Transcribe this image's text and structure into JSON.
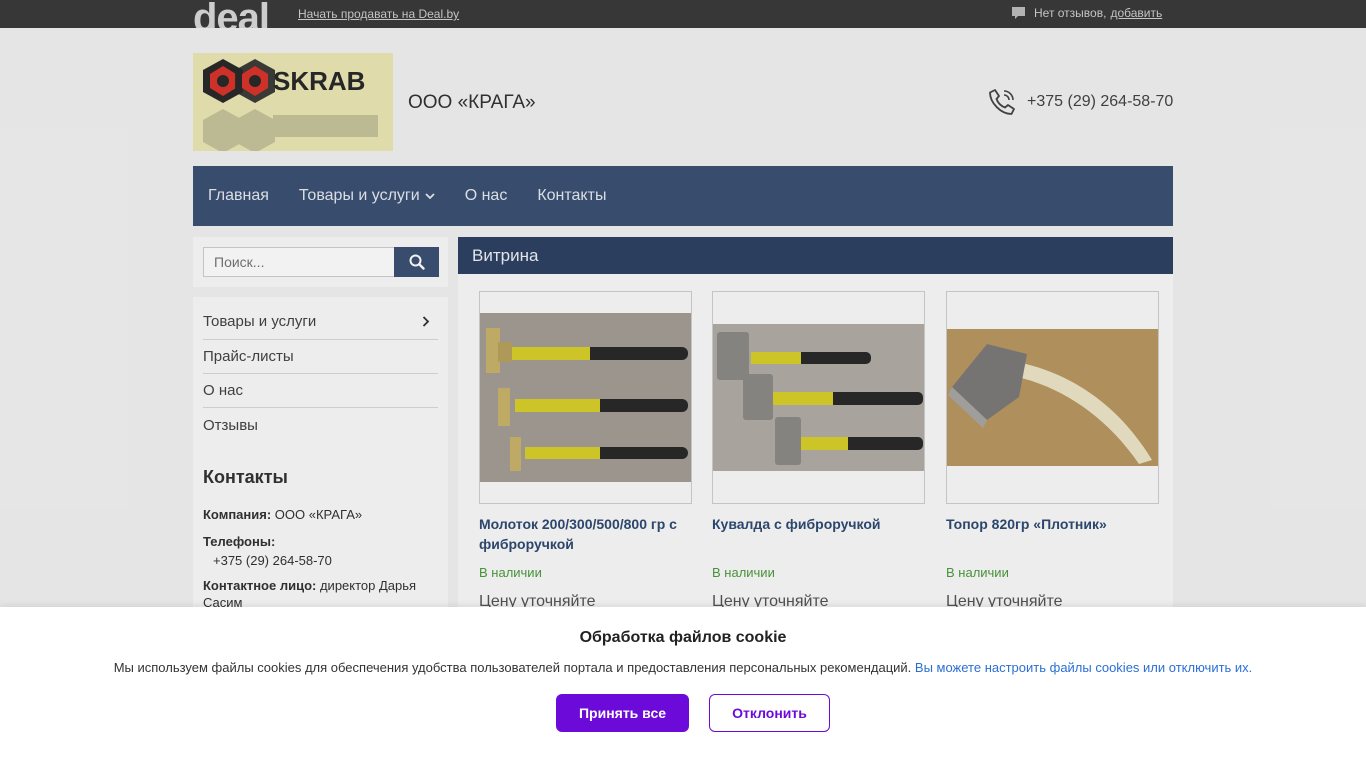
{
  "topbar": {
    "logo": "deal",
    "sell_link": "Начать продавать на Deal.by",
    "reviews_text": "Нет отзывов,",
    "reviews_add": "добавить"
  },
  "header": {
    "logo_text": "SKRAB",
    "company_name": "ООО «КРАГА»",
    "phone": "+375 (29) 264-58-70"
  },
  "nav": {
    "items": [
      {
        "label": "Главная"
      },
      {
        "label": "Товары и услуги"
      },
      {
        "label": "О нас"
      },
      {
        "label": "Контакты"
      }
    ]
  },
  "search": {
    "placeholder": "Поиск..."
  },
  "sidebar": {
    "items": [
      {
        "label": "Товары и услуги"
      },
      {
        "label": "Прайс-листы"
      },
      {
        "label": "О нас"
      },
      {
        "label": "Отзывы"
      }
    ],
    "contacts": {
      "title": "Контакты",
      "company_label": "Компания:",
      "company_value": "ООО «КРАГА»",
      "phones_label": "Телефоны:",
      "phone_value": "+375 (29) 264-58-70",
      "person_label": "Контактное лицо:",
      "person_value": "директор Дарья Сасим"
    }
  },
  "main": {
    "title": "Витрина",
    "products": [
      {
        "title": "Молоток 200/300/500/800 гр с фиброручкой",
        "stock": "В наличии",
        "price": "Цену уточняйте"
      },
      {
        "title": "Кувалда с фиброручкой",
        "stock": "В наличии",
        "price": "Цену уточняйте"
      },
      {
        "title": "Топор 820гр «Плотник»",
        "stock": "В наличии",
        "price": "Цену уточняйте"
      }
    ]
  },
  "cookie": {
    "title": "Обработка файлов cookie",
    "text": "Мы используем файлы cookies для обеспечения удобства пользователей портала и предоставления персональных рекомендаций.",
    "link": "Вы можете настроить файлы cookies или отключить их.",
    "accept": "Принять все",
    "decline": "Отклонить"
  },
  "colors": {
    "nav_bg": "#3c5173",
    "accent": "#6c0bd9",
    "in_stock": "#4c9a3d",
    "product_title": "#2f4a72"
  }
}
